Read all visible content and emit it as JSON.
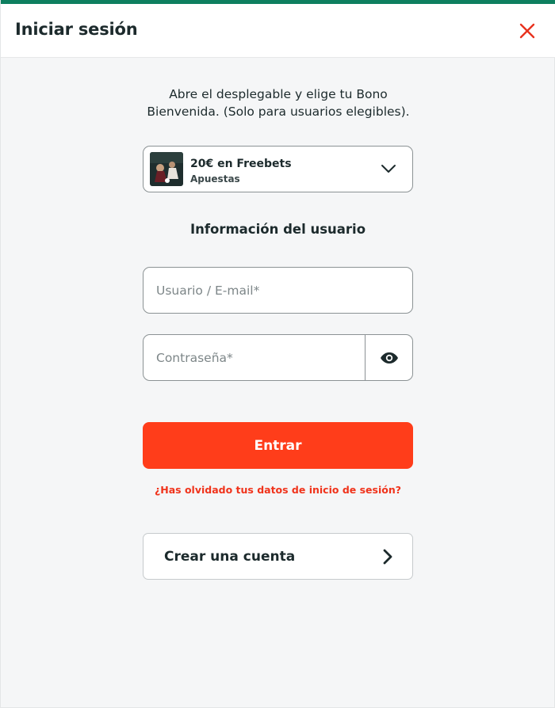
{
  "header": {
    "title": "Iniciar sesión",
    "close_icon": "close-icon",
    "accent_color": "#0e7f5f",
    "close_color": "#e8321e"
  },
  "bonus": {
    "intro": "Abre el desplegable y elige tu Bono Bienvenida. (Solo para usuarios elegibles).",
    "selected_title": "20€ en Freebets",
    "selected_subtitle": "Apuestas",
    "dropdown_icon": "chevron-down-icon"
  },
  "user_info": {
    "section_title": "Información del usuario",
    "username_placeholder": "Usuario / E-mail*",
    "username_value": "",
    "password_placeholder": "Contraseña*",
    "password_value": "",
    "show_password_icon": "eye-icon"
  },
  "actions": {
    "submit_label": "Entrar",
    "submit_color": "#ff3d1a",
    "forgot_label": "¿Has olvidado tus datos de inicio de sesión?",
    "forgot_color": "#f0331b",
    "create_account_label": "Crear una cuenta",
    "create_account_icon": "chevron-right-icon"
  }
}
